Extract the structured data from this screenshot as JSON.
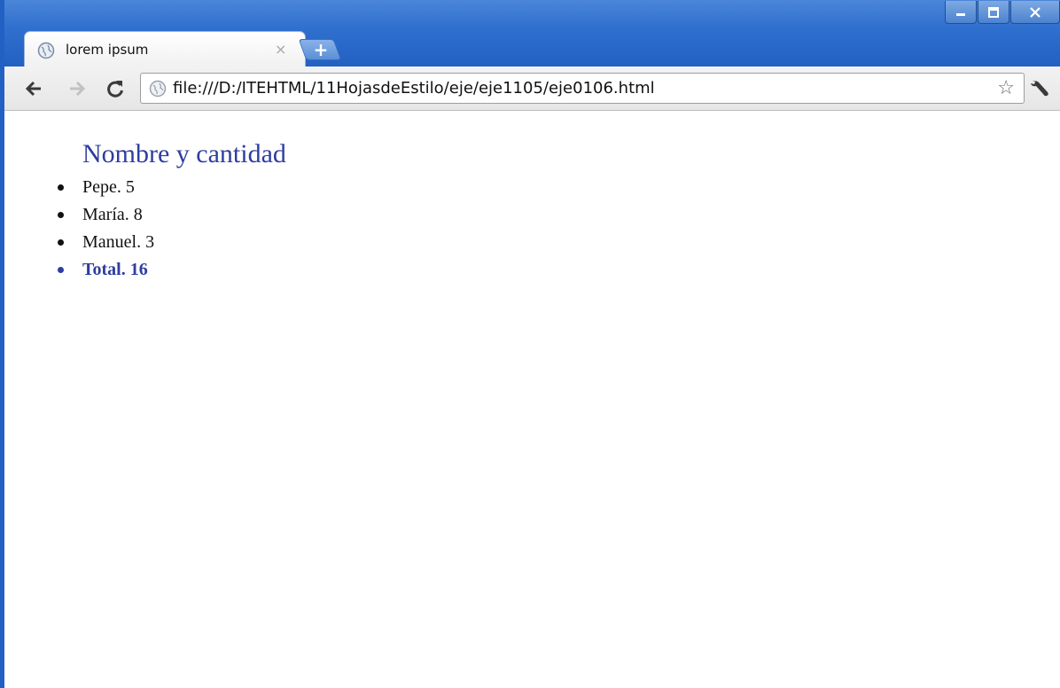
{
  "browser": {
    "tab": {
      "title": "lorem ipsum",
      "close_glyph": "×",
      "favicon": "globe-icon"
    },
    "new_tab_glyph": "+",
    "address": {
      "url": "file:///D:/ITEHTML/11HojasdeEstilo/eje/eje1105/eje0106.html",
      "page_icon": "globe-icon"
    },
    "toolbar_icons": [
      "back-icon",
      "forward-icon",
      "reload-icon",
      "star-icon",
      "wrench-icon"
    ],
    "window_controls": [
      "minimize-icon",
      "maximize-icon",
      "close-icon"
    ],
    "star_glyph": "☆"
  },
  "page": {
    "heading": "Nombre y cantidad",
    "items": [
      {
        "text": "Pepe. 5"
      },
      {
        "text": "María. 8"
      },
      {
        "text": "Manuel. 3"
      }
    ],
    "total": {
      "text": "Total. 16"
    }
  },
  "colors": {
    "heading": "#2e3da0",
    "total": "#2e3da0",
    "titlebar": "#2f6fce"
  }
}
